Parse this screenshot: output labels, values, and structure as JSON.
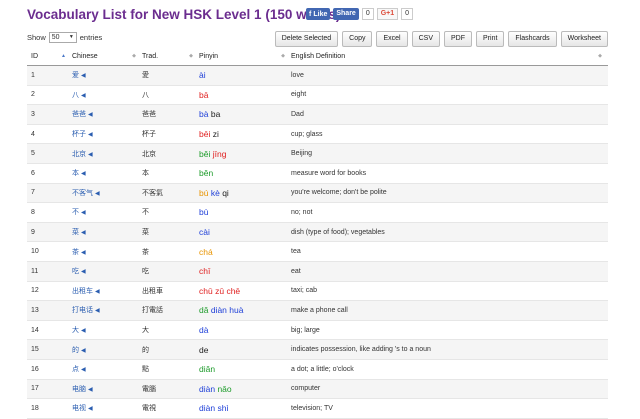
{
  "page": {
    "title": "Vocabulary List for New HSK Level 1 (150 words)"
  },
  "social": {
    "like": "Like",
    "share": "Share",
    "share_count": "0",
    "gplus": "G+1",
    "gplus_count": "0"
  },
  "length": {
    "prefix": "Show",
    "value": "50",
    "suffix": "entries"
  },
  "toolbar": [
    "Delete Selected",
    "Copy",
    "Excel",
    "CSV",
    "PDF",
    "Print",
    "Flashcards",
    "Worksheet"
  ],
  "headers": {
    "id": "ID",
    "chinese": "Chinese",
    "trad": "Trad.",
    "pinyin": "Pinyin",
    "definition": "English Definition"
  },
  "rows": [
    {
      "id": "1",
      "zh": "爱",
      "trad": "愛",
      "py": [
        [
          "ài",
          4
        ]
      ],
      "def": "love"
    },
    {
      "id": "2",
      "zh": "八",
      "trad": "八",
      "py": [
        [
          "bā",
          1
        ]
      ],
      "def": "eight"
    },
    {
      "id": "3",
      "zh": "爸爸",
      "trad": "爸爸",
      "py": [
        [
          "bà",
          4
        ],
        [
          "ba",
          5
        ]
      ],
      "def": "Dad"
    },
    {
      "id": "4",
      "zh": "杯子",
      "trad": "杯子",
      "py": [
        [
          "bēi",
          1
        ],
        [
          "zi",
          5
        ]
      ],
      "def": "cup; glass"
    },
    {
      "id": "5",
      "zh": "北京",
      "trad": "北京",
      "py": [
        [
          "běi",
          3
        ],
        [
          "jīng",
          1
        ]
      ],
      "def": "Beijing"
    },
    {
      "id": "6",
      "zh": "本",
      "trad": "本",
      "py": [
        [
          "běn",
          3
        ]
      ],
      "def": "measure word for books"
    },
    {
      "id": "7",
      "zh": "不客气",
      "trad": "不客氣",
      "py": [
        [
          "bú",
          2
        ],
        [
          "kè",
          4
        ],
        [
          "qi",
          5
        ]
      ],
      "def": "you're welcome; don't be polite"
    },
    {
      "id": "8",
      "zh": "不",
      "trad": "不",
      "py": [
        [
          "bù",
          4
        ]
      ],
      "def": "no; not"
    },
    {
      "id": "9",
      "zh": "菜",
      "trad": "菜",
      "py": [
        [
          "cài",
          4
        ]
      ],
      "def": "dish (type of food); vegetables"
    },
    {
      "id": "10",
      "zh": "茶",
      "trad": "茶",
      "py": [
        [
          "chá",
          2
        ]
      ],
      "def": "tea"
    },
    {
      "id": "11",
      "zh": "吃",
      "trad": "吃",
      "py": [
        [
          "chī",
          1
        ]
      ],
      "def": "eat"
    },
    {
      "id": "12",
      "zh": "出租车",
      "trad": "出租車",
      "py": [
        [
          "chū",
          1
        ],
        [
          "zū",
          1
        ],
        [
          "chē",
          1
        ]
      ],
      "def": "taxi; cab"
    },
    {
      "id": "13",
      "zh": "打电话",
      "trad": "打電話",
      "py": [
        [
          "dǎ",
          3
        ],
        [
          "diàn",
          4
        ],
        [
          "huà",
          4
        ]
      ],
      "def": "make a phone call"
    },
    {
      "id": "14",
      "zh": "大",
      "trad": "大",
      "py": [
        [
          "dà",
          4
        ]
      ],
      "def": "big; large"
    },
    {
      "id": "15",
      "zh": "的",
      "trad": "的",
      "py": [
        [
          "de",
          5
        ]
      ],
      "def": "indicates possession, like adding 's to a noun"
    },
    {
      "id": "16",
      "zh": "点",
      "trad": "點",
      "py": [
        [
          "diǎn",
          3
        ]
      ],
      "def": "a dot; a little; o'clock"
    },
    {
      "id": "17",
      "zh": "电脑",
      "trad": "電腦",
      "py": [
        [
          "diàn",
          4
        ],
        [
          "nǎo",
          3
        ]
      ],
      "def": "computer"
    },
    {
      "id": "18",
      "zh": "电视",
      "trad": "電視",
      "py": [
        [
          "diàn",
          4
        ],
        [
          "shì",
          4
        ]
      ],
      "def": "television; TV"
    }
  ]
}
